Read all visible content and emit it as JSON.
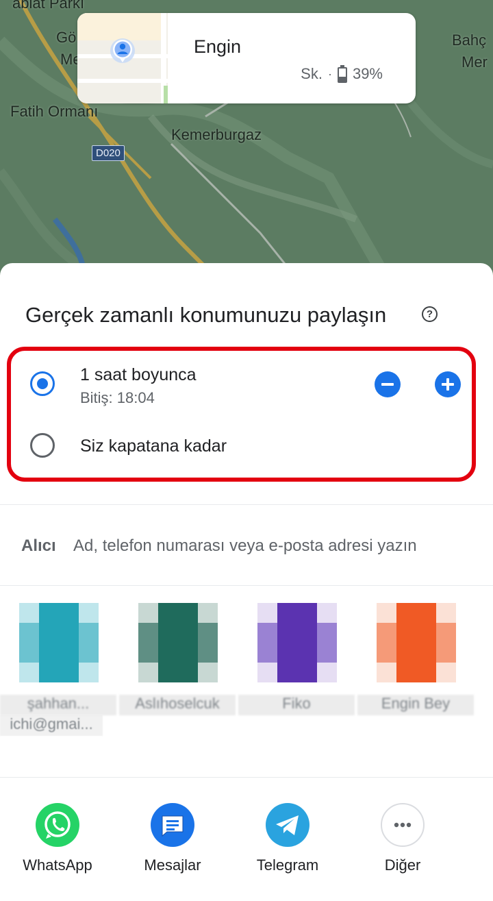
{
  "map": {
    "labels": {
      "park": "ablat Parkı",
      "west_top": "Gö",
      "west_bottom": "Me",
      "forest": "Fatih Ormanı",
      "town": "Kemerburgaz",
      "east_top": "Bahç",
      "east_bottom": "Mer",
      "road_shield": "D020"
    }
  },
  "person_card": {
    "name": "Engin",
    "status_prefix": "Sk.",
    "separator": "·",
    "battery_percent_text": "39%",
    "battery_level": 0.39,
    "pin_icon": "person-pin-icon"
  },
  "sheet": {
    "title": "Gerçek zamanlı konumunuzu paylaşın",
    "help_icon": "help-icon",
    "help_glyph": "?",
    "highlight_color": "#e3000f",
    "accent_color": "#1a73e8",
    "options": {
      "duration": {
        "label": "1 saat boyunca",
        "sub": "Bitiş: 18:04",
        "selected": true
      },
      "until_off": {
        "label": "Siz kapatana kadar",
        "selected": false
      }
    },
    "recipient": {
      "label": "Alıcı",
      "placeholder": "Ad, telefon numarası veya e-posta adresi yazın"
    },
    "contacts": [
      {
        "name": "şahhan...",
        "email": "ichi@gmai...",
        "color": "#24a5b8"
      },
      {
        "name": "Aslıhoselcuk",
        "email": "",
        "color": "#1f6b5c"
      },
      {
        "name": "Fiko",
        "email": "",
        "color": "#5b33b0"
      },
      {
        "name": "Engin Bey",
        "email": "",
        "color": "#f05a25"
      }
    ],
    "apps": [
      {
        "label": "WhatsApp",
        "icon": "whatsapp-icon",
        "color": "#25d366"
      },
      {
        "label": "Mesajlar",
        "icon": "messages-icon",
        "color": "#1a73e8"
      },
      {
        "label": "Telegram",
        "icon": "telegram-icon",
        "color": "#2aa3df"
      },
      {
        "label": "Diğer",
        "icon": "more-icon",
        "color": "#ffffff"
      }
    ]
  }
}
